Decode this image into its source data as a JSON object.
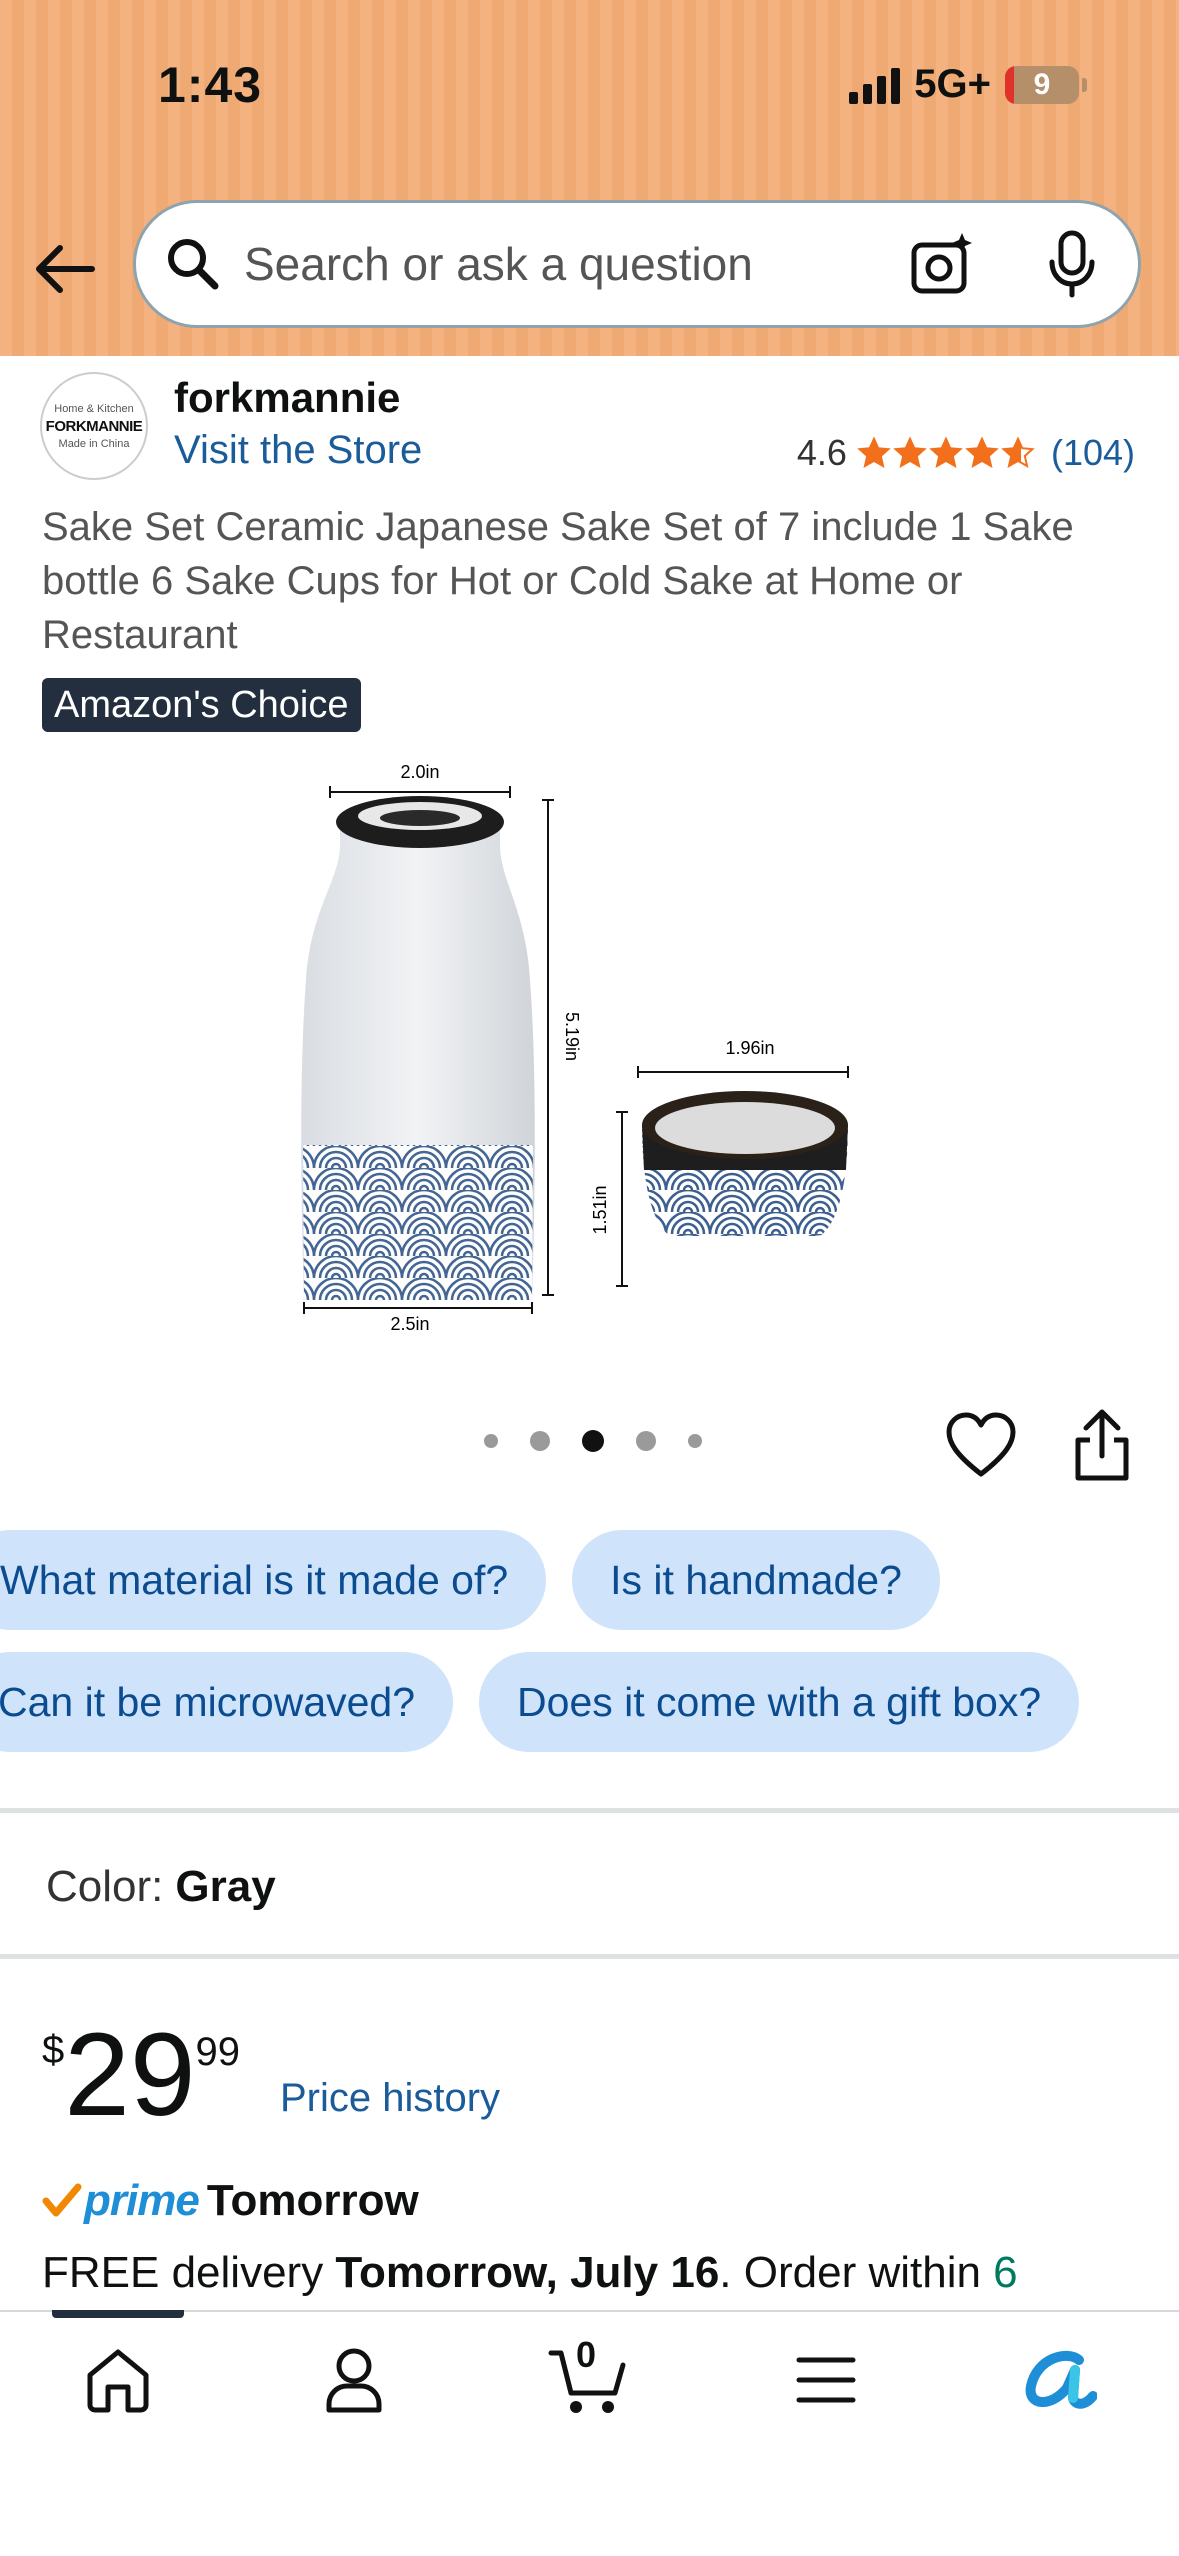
{
  "status_bar": {
    "time": "1:43",
    "network": "5G+",
    "battery": "9"
  },
  "search": {
    "placeholder": "Search or ask a question"
  },
  "store": {
    "logo_text_top": "Home & Kitchen",
    "logo_text_main": "FORKMANNIE",
    "logo_text_bottom": "Made in China",
    "name": "forkmannie",
    "visit_label": "Visit the Store",
    "rating_value": "4.6",
    "rating_stars": 4.6,
    "rating_count": "(104)"
  },
  "product": {
    "title": "Sake Set Ceramic Japanese Sake Set of 7 include 1 Sake bottle 6 Sake Cups for Hot or Cold Sake at Home or Restaurant",
    "badge": "Amazon's Choice",
    "image_labels": {
      "bottle_top_width": "2.0in",
      "bottle_height": "5.19in",
      "bottle_base_width": "2.5in",
      "cup_width": "1.96in",
      "cup_height": "1.51in"
    },
    "carousel": {
      "total": 5,
      "active": 3
    }
  },
  "questions": {
    "row1": [
      "What material is it made of?",
      "Is it handmade?"
    ],
    "row2": [
      "Can it be microwaved?",
      "Does it come with a gift box?"
    ]
  },
  "color": {
    "label": "Color:",
    "value": "Gray"
  },
  "price": {
    "symbol": "$",
    "whole": "29",
    "fraction": "99",
    "history_label": "Price history"
  },
  "delivery": {
    "prime_label": "prime",
    "prime_speed": "Tomorrow",
    "free_prefix": "FREE delivery ",
    "date": "Tomorrow, July 16",
    "order_within": ". Order within ",
    "countdown": "6"
  },
  "tabbar": {
    "cart_count": "0"
  },
  "colors": {
    "header_bg": "#f3b27f",
    "link": "#1a5b9a",
    "chip_bg": "#cfe3fb",
    "star": "#f26f1b",
    "prime": "#1e8ed6"
  }
}
